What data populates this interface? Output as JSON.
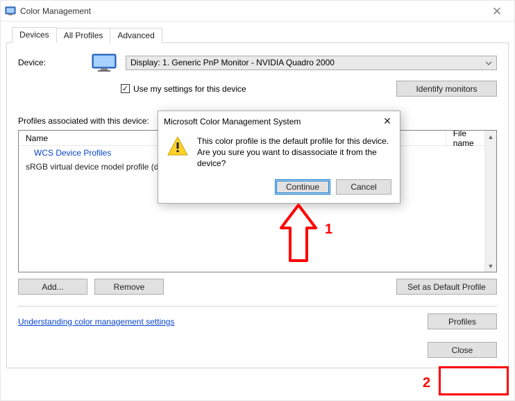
{
  "window": {
    "title": "Color Management"
  },
  "tabs": {
    "devices": "Devices",
    "all_profiles": "All Profiles",
    "advanced": "Advanced"
  },
  "device": {
    "label": "Device:",
    "selected": "Display: 1. Generic PnP Monitor - NVIDIA Quadro 2000",
    "use_my_settings": "Use my settings for this device",
    "identify_btn": "Identify monitors"
  },
  "profiles_section": {
    "label": "Profiles associated with this device:",
    "columns": {
      "name": "Name",
      "file": "File name"
    },
    "group": "WCS Device Profiles",
    "item": "sRGB virtual device model profile (default)"
  },
  "buttons": {
    "add": "Add...",
    "remove": "Remove",
    "set_default": "Set as Default Profile",
    "profiles": "Profiles",
    "close": "Close"
  },
  "link": "Understanding color management settings",
  "dialog": {
    "title": "Microsoft Color Management System",
    "message": "This color profile is the default profile for this device. Are you sure you want to disassociate it from the device?",
    "continue": "Continue",
    "cancel": "Cancel"
  },
  "annotations": {
    "one": "1",
    "two": "2"
  }
}
